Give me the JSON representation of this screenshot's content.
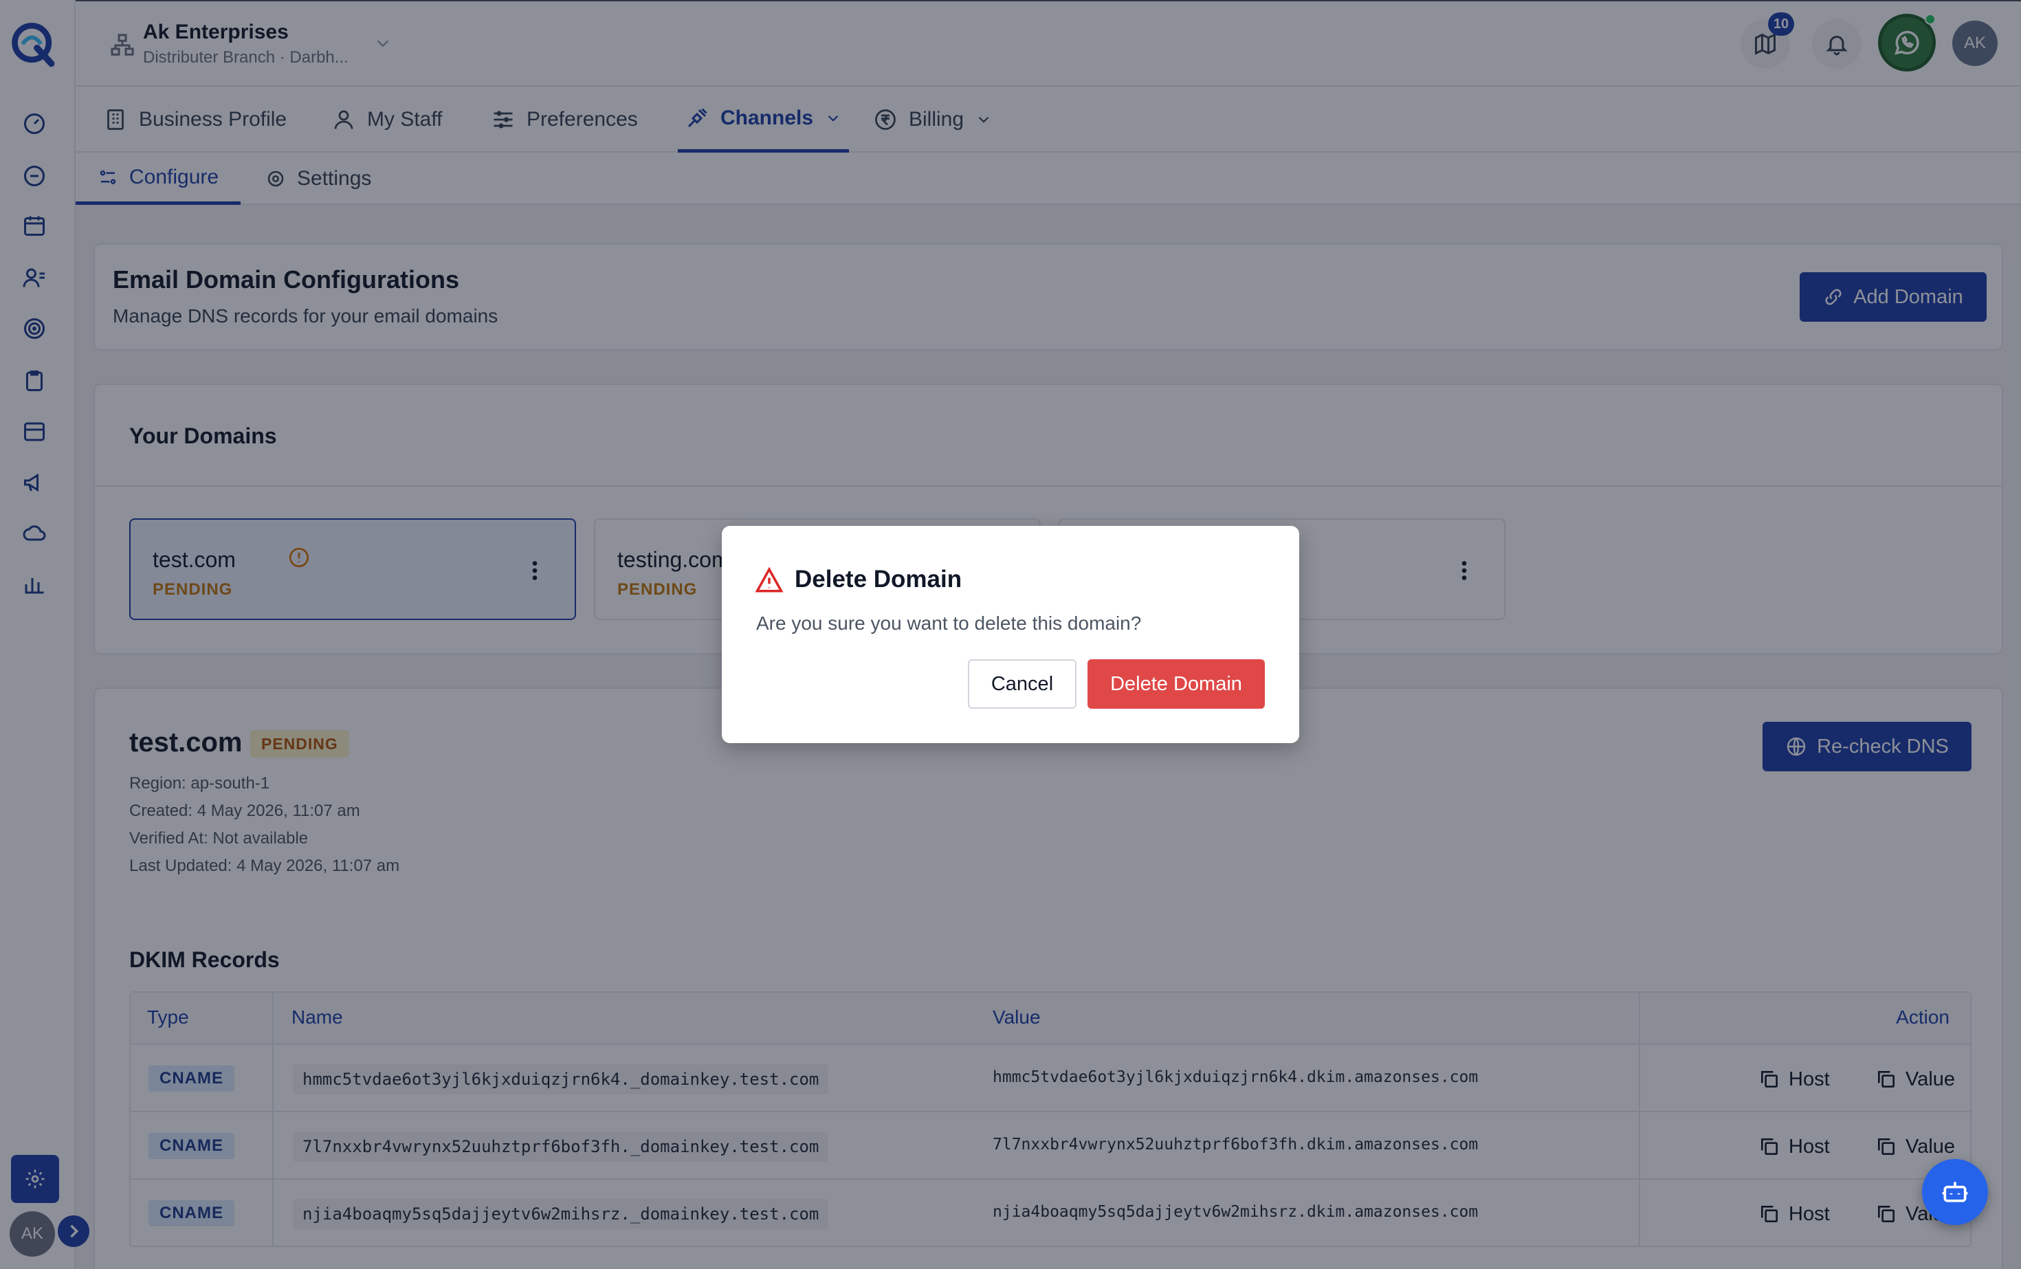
{
  "header": {
    "org_name": "Ak Enterprises",
    "org_sub": "Distributer Branch · Darbh...",
    "notification_count": "10",
    "user_initials": "AK"
  },
  "sidebar": {
    "user_initials": "AK"
  },
  "tabs": [
    {
      "label": "Business Profile",
      "icon": "building-icon"
    },
    {
      "label": "My Staff",
      "icon": "user-icon"
    },
    {
      "label": "Preferences",
      "icon": "sliders-icon"
    },
    {
      "label": "Channels",
      "icon": "plug-icon"
    },
    {
      "label": "Billing",
      "icon": "rupee-icon"
    }
  ],
  "subtabs": [
    {
      "label": "Configure",
      "icon": "configure-icon"
    },
    {
      "label": "Settings",
      "icon": "gear-icon"
    }
  ],
  "config": {
    "title": "Email Domain Configurations",
    "subtitle": "Manage DNS records for your email domains",
    "add_label": "Add Domain"
  },
  "domains": {
    "title": "Your Domains",
    "items": [
      {
        "name": "test.com",
        "status": "PENDING"
      },
      {
        "name": "testing.com",
        "status": "PENDING"
      },
      {
        "name": "",
        "status": ""
      }
    ]
  },
  "detail": {
    "name": "test.com",
    "status": "PENDING",
    "region": "Region: ap-south-1",
    "created": "Created: 4 May 2026, 11:07 am",
    "verified": "Verified At: Not available",
    "updated": "Last Updated: 4 May 2026, 11:07 am",
    "recheck_label": "Re-check DNS",
    "dkim_title": "DKIM Records",
    "columns": {
      "type": "Type",
      "name": "Name",
      "value": "Value",
      "action": "Action"
    },
    "host_label": "Host",
    "value_label": "Value",
    "records": [
      {
        "type": "CNAME",
        "name": "hmmc5tvdae6ot3yjl6kjxduiqzjrn6k4._domainkey.test.com",
        "value": "hmmc5tvdae6ot3yjl6kjxduiqzjrn6k4.dkim.amazonses.com"
      },
      {
        "type": "CNAME",
        "name": "7l7nxxbr4vwrynx52uuhztprf6bof3fh._domainkey.test.com",
        "value": "7l7nxxbr4vwrynx52uuhztprf6bof3fh.dkim.amazonses.com"
      },
      {
        "type": "CNAME",
        "name": "njia4boaqmy5sq5dajjeytv6w2mihsrz._domainkey.test.com",
        "value": "njia4boaqmy5sq5dajjeytv6w2mihsrz.dkim.amazonses.com"
      }
    ]
  },
  "modal": {
    "title": "Delete Domain",
    "message": "Are you sure you want to delete this domain?",
    "cancel_label": "Cancel",
    "delete_label": "Delete Domain"
  },
  "colors": {
    "primary": "#1e3fa8",
    "danger": "#e04848",
    "pending": "#c2780a"
  }
}
